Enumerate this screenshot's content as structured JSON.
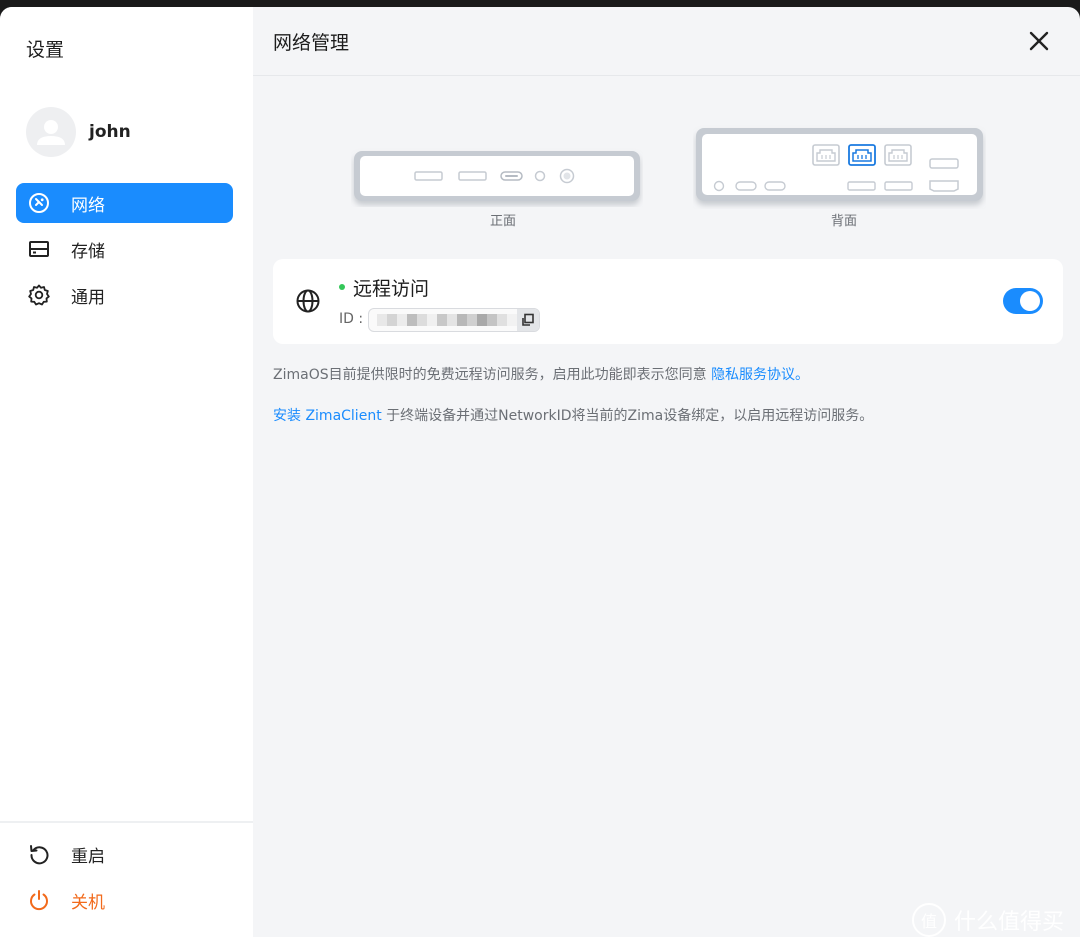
{
  "sidebar": {
    "title": "设置",
    "user": {
      "name": "john"
    },
    "nav": [
      {
        "label": "网络",
        "icon": "network-icon",
        "active": true
      },
      {
        "label": "存储",
        "icon": "storage-icon",
        "active": false
      },
      {
        "label": "通用",
        "icon": "gear-icon",
        "active": false
      }
    ],
    "bottom": [
      {
        "label": "重启",
        "icon": "restart-icon"
      },
      {
        "label": "关机",
        "icon": "power-icon"
      }
    ]
  },
  "main": {
    "title": "网络管理",
    "device": {
      "front_label": "正面",
      "back_label": "背面"
    },
    "remote": {
      "title": "远程访问",
      "id_label": "ID :",
      "enabled": true,
      "status": "online"
    },
    "notice": {
      "text": "ZimaOS目前提供限时的免费远程访问服务，启用此功能即表示您同意",
      "link": "隐私服务协议。"
    },
    "install": {
      "link": "安装 ZimaClient",
      "text": " 于终端设备并通过NetworkID将当前的Zima设备绑定，以启用远程访问服务。"
    }
  },
  "watermark": {
    "logo": "值",
    "text": "什么值得买"
  },
  "colors": {
    "accent": "#1a8cfe",
    "danger": "#f26a1b",
    "online": "#34c759"
  }
}
